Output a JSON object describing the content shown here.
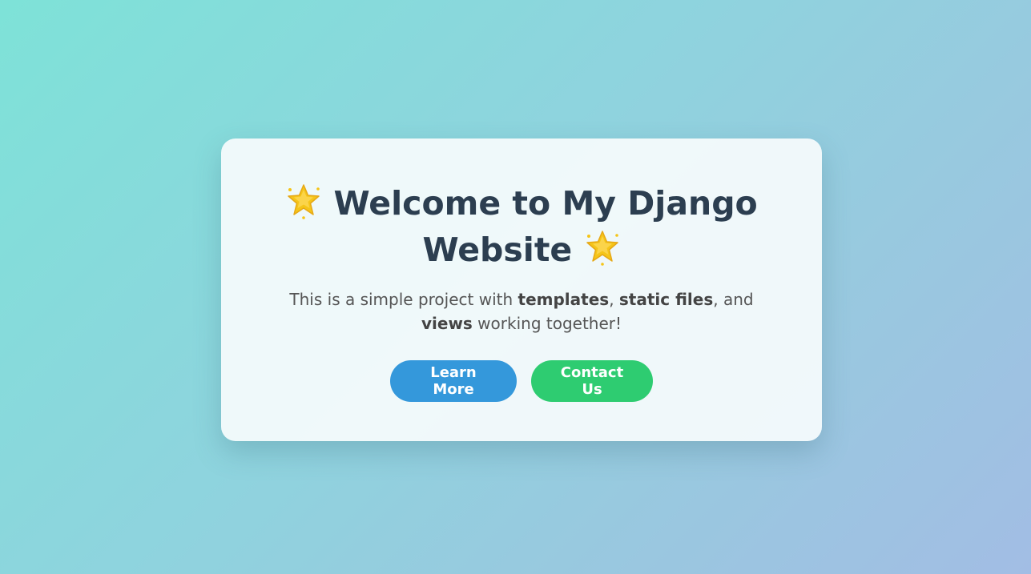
{
  "hero": {
    "title_text": "Welcome to My Django Website",
    "title_part1": "Welcome to My Django",
    "title_part2": "Website",
    "leading_icon": "glowing-star-icon",
    "trailing_icon": "glowing-star-icon",
    "desc_pre": "This is a simple project with ",
    "desc_b1": "templates",
    "desc_sep1": ", ",
    "desc_b2": "static files",
    "desc_sep2": ", and ",
    "desc_b3": "views",
    "desc_post": " working together!"
  },
  "buttons": {
    "learn_more": "Learn More",
    "contact_us": "Contact Us"
  },
  "colors": {
    "title": "#2c3e50",
    "learn_more_bg": "#3498db",
    "contact_us_bg": "#2ecc71",
    "star": "#f5c518"
  }
}
